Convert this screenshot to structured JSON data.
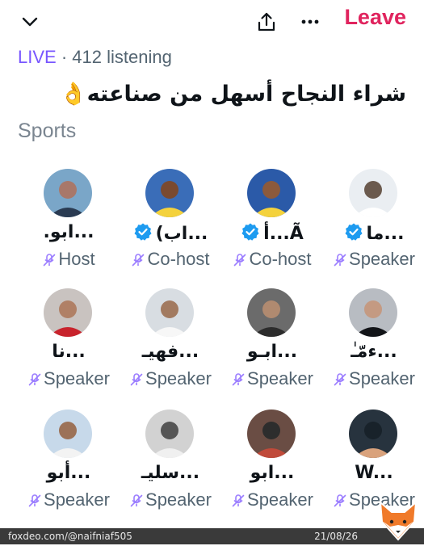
{
  "header": {
    "leave_label": "Leave",
    "status_live": "LIVE",
    "status_sep": " · ",
    "listening": "412 listening",
    "title": "شراء النجاح أسهل من صناعته👌",
    "topic": "Sports"
  },
  "colors": {
    "accent": "#7856ff",
    "leave": "#e0245e",
    "verified": "#1d9bf0"
  },
  "icons": [
    "chevron-down-icon",
    "share-icon",
    "more-icon",
    "mic-off-icon",
    "verified-icon"
  ],
  "participants": [
    {
      "name": "ما...",
      "role": "Speaker",
      "verified": true,
      "avatar": [
        "#eaeef2",
        "#ffffff",
        "#6b5a4e"
      ]
    },
    {
      "name": "أ...Ã",
      "role": "Co-host",
      "verified": true,
      "avatar": [
        "#2b5aa8",
        "#f4d23c",
        "#8c5a3c"
      ]
    },
    {
      "name": "(اب...",
      "role": "Co-host",
      "verified": true,
      "avatar": [
        "#3a6db8",
        "#f4d23c",
        "#7a4a30"
      ]
    },
    {
      "name": ".ابو...",
      "role": "Host",
      "verified": false,
      "avatar": [
        "#7aa6c8",
        "#2a3b52",
        "#a8786a"
      ]
    },
    {
      "name": "ءمّـٰ...",
      "role": "Speaker",
      "verified": false,
      "avatar": [
        "#b8bcc2",
        "#121418",
        "#c49a82"
      ]
    },
    {
      "name": "ابـو...",
      "role": "Speaker",
      "verified": false,
      "avatar": [
        "#6b6b6b",
        "#2c2c2c",
        "#b08a70"
      ]
    },
    {
      "name": "فهيـ...",
      "role": "Speaker",
      "verified": false,
      "avatar": [
        "#d8dde2",
        "#f7f7f7",
        "#a27a60"
      ]
    },
    {
      "name": "نا...",
      "role": "Speaker",
      "verified": false,
      "avatar": [
        "#c9c3c0",
        "#c8232c",
        "#b08066"
      ]
    },
    {
      "name": "W...",
      "role": "Speaker",
      "verified": false,
      "avatar": [
        "#27333e",
        "#d9a27c",
        "#18222a"
      ]
    },
    {
      "name": "ابو...",
      "role": "Speaker",
      "verified": false,
      "avatar": [
        "#6a4d44",
        "#c04a3a",
        "#2d2d2d"
      ]
    },
    {
      "name": "سليـ...",
      "role": "Speaker",
      "verified": false,
      "avatar": [
        "#d2d2d2",
        "#f0f0f0",
        "#555555"
      ]
    },
    {
      "name": "أبو...",
      "role": "Speaker",
      "verified": false,
      "avatar": [
        "#c7d9ea",
        "#f3f3f3",
        "#9c7258"
      ]
    }
  ],
  "footer": {
    "source": "foxdeo.com/@naifniaf505",
    "date": "21/08/26"
  }
}
